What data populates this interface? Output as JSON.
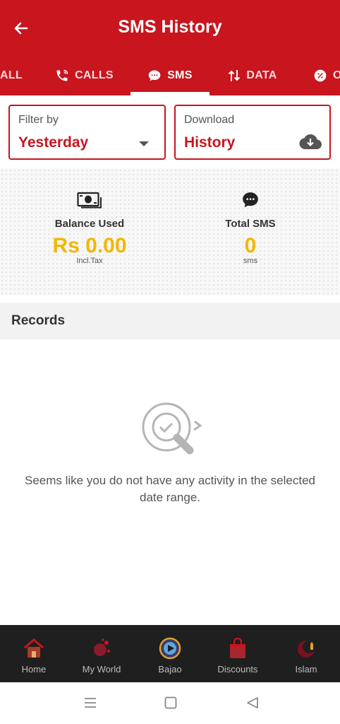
{
  "header": {
    "title": "SMS History"
  },
  "tabs": [
    {
      "label": "ALL"
    },
    {
      "label": "CALLS"
    },
    {
      "label": "SMS",
      "active": true
    },
    {
      "label": "DATA"
    },
    {
      "label": "O"
    }
  ],
  "filter": {
    "label": "Filter by",
    "value": "Yesterday"
  },
  "download": {
    "label": "Download",
    "value": "History"
  },
  "stats": {
    "balance": {
      "label": "Balance Used",
      "value": "Rs 0.00",
      "sub": "Incl.Tax"
    },
    "sms": {
      "label": "Total SMS",
      "value": "0",
      "sub": "sms"
    }
  },
  "records": {
    "title": "Records",
    "empty_message": "Seems like you do not have any activity in the selected date range."
  },
  "bottom_nav": [
    {
      "label": "Home",
      "icon": "home-icon"
    },
    {
      "label": "My World",
      "icon": "my-world-icon"
    },
    {
      "label": "Bajao",
      "icon": "bajao-icon"
    },
    {
      "label": "Discounts",
      "icon": "discounts-icon"
    },
    {
      "label": "Islam",
      "icon": "islam-icon"
    }
  ],
  "colors": {
    "brand_red": "#c8151e",
    "accent_yellow": "#f2b705",
    "nav_bg": "#1f1f1f"
  }
}
